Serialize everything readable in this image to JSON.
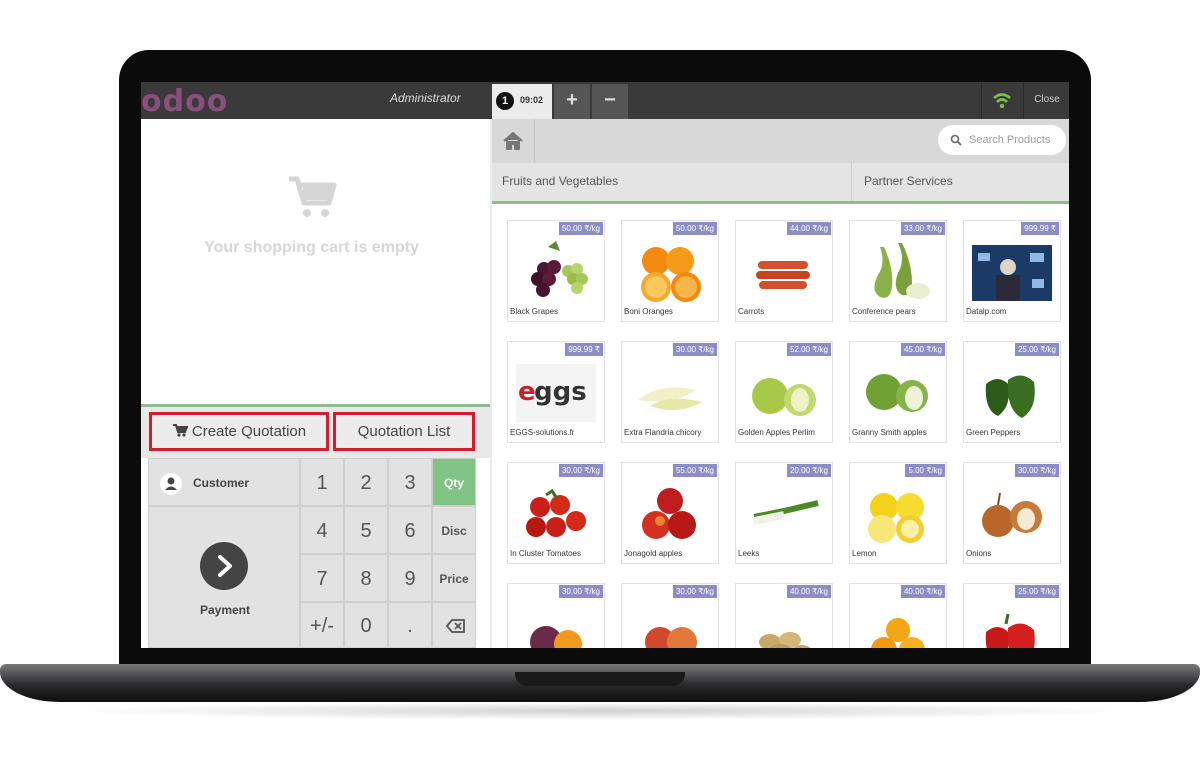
{
  "header": {
    "logo": "odoo",
    "user": "Administrator",
    "order_number": "1",
    "order_time": "09:02",
    "add_label": "+",
    "remove_label": "−",
    "close_label": "Close",
    "wifi_color": "#7bc043"
  },
  "cart": {
    "empty_text": "Your shopping cart is empty"
  },
  "actions": {
    "create_quotation": "Create Quotation",
    "quotation_list": "Quotation List"
  },
  "numpad": {
    "customer": "Customer",
    "payment": "Payment",
    "keys": [
      "1",
      "2",
      "3",
      "4",
      "5",
      "6",
      "7",
      "8",
      "9",
      "+/-",
      "0",
      "."
    ],
    "modes": [
      "Qty",
      "Disc",
      "Price"
    ],
    "active_mode": "Qty"
  },
  "search": {
    "placeholder": "Search Products"
  },
  "categories": [
    "Fruits and Vegetables",
    "Partner Services"
  ],
  "products": [
    {
      "name": "Black Grapes",
      "price": "50.00 ₹/kg",
      "icon": "grapes"
    },
    {
      "name": "Boni Oranges",
      "price": "50.00 ₹/kg",
      "icon": "oranges"
    },
    {
      "name": "Carrots",
      "price": "44.00 ₹/kg",
      "icon": "carrots"
    },
    {
      "name": "Conference pears",
      "price": "33.00 ₹/kg",
      "icon": "pears"
    },
    {
      "name": "Datalp.com",
      "price": "999.99 ₹",
      "icon": "datalp-image"
    },
    {
      "name": "EGGS-solutions.fr",
      "price": "999.99 ₹",
      "icon": "eggs-logo"
    },
    {
      "name": "Extra Flandria chicory",
      "price": "30.00 ₹/kg",
      "icon": "chicory"
    },
    {
      "name": "Golden Apples Perlim",
      "price": "52.00 ₹/kg",
      "icon": "golden-apples"
    },
    {
      "name": "Granny Smith apples",
      "price": "45.00 ₹/kg",
      "icon": "green-apples"
    },
    {
      "name": "Green Peppers",
      "price": "25.00 ₹/kg",
      "icon": "green-peppers"
    },
    {
      "name": "In Cluster Tomatoes",
      "price": "30.00 ₹/kg",
      "icon": "tomatoes"
    },
    {
      "name": "Jonagold apples",
      "price": "55.00 ₹/kg",
      "icon": "red-apples"
    },
    {
      "name": "Leeks",
      "price": "20.00 ₹/kg",
      "icon": "leeks"
    },
    {
      "name": "Lemon",
      "price": "5.00 ₹/kg",
      "icon": "lemons"
    },
    {
      "name": "Onions",
      "price": "30.00 ₹/kg",
      "icon": "onions"
    },
    {
      "name": "",
      "price": "30.00 ₹/kg",
      "icon": "passion-fruit"
    },
    {
      "name": "",
      "price": "30.00 ₹/kg",
      "icon": "peaches"
    },
    {
      "name": "",
      "price": "40.00 ₹/kg",
      "icon": "potatoes"
    },
    {
      "name": "",
      "price": "40.00 ₹/kg",
      "icon": "oranges-2"
    },
    {
      "name": "",
      "price": "25.00 ₹/kg",
      "icon": "red-peppers"
    }
  ]
}
